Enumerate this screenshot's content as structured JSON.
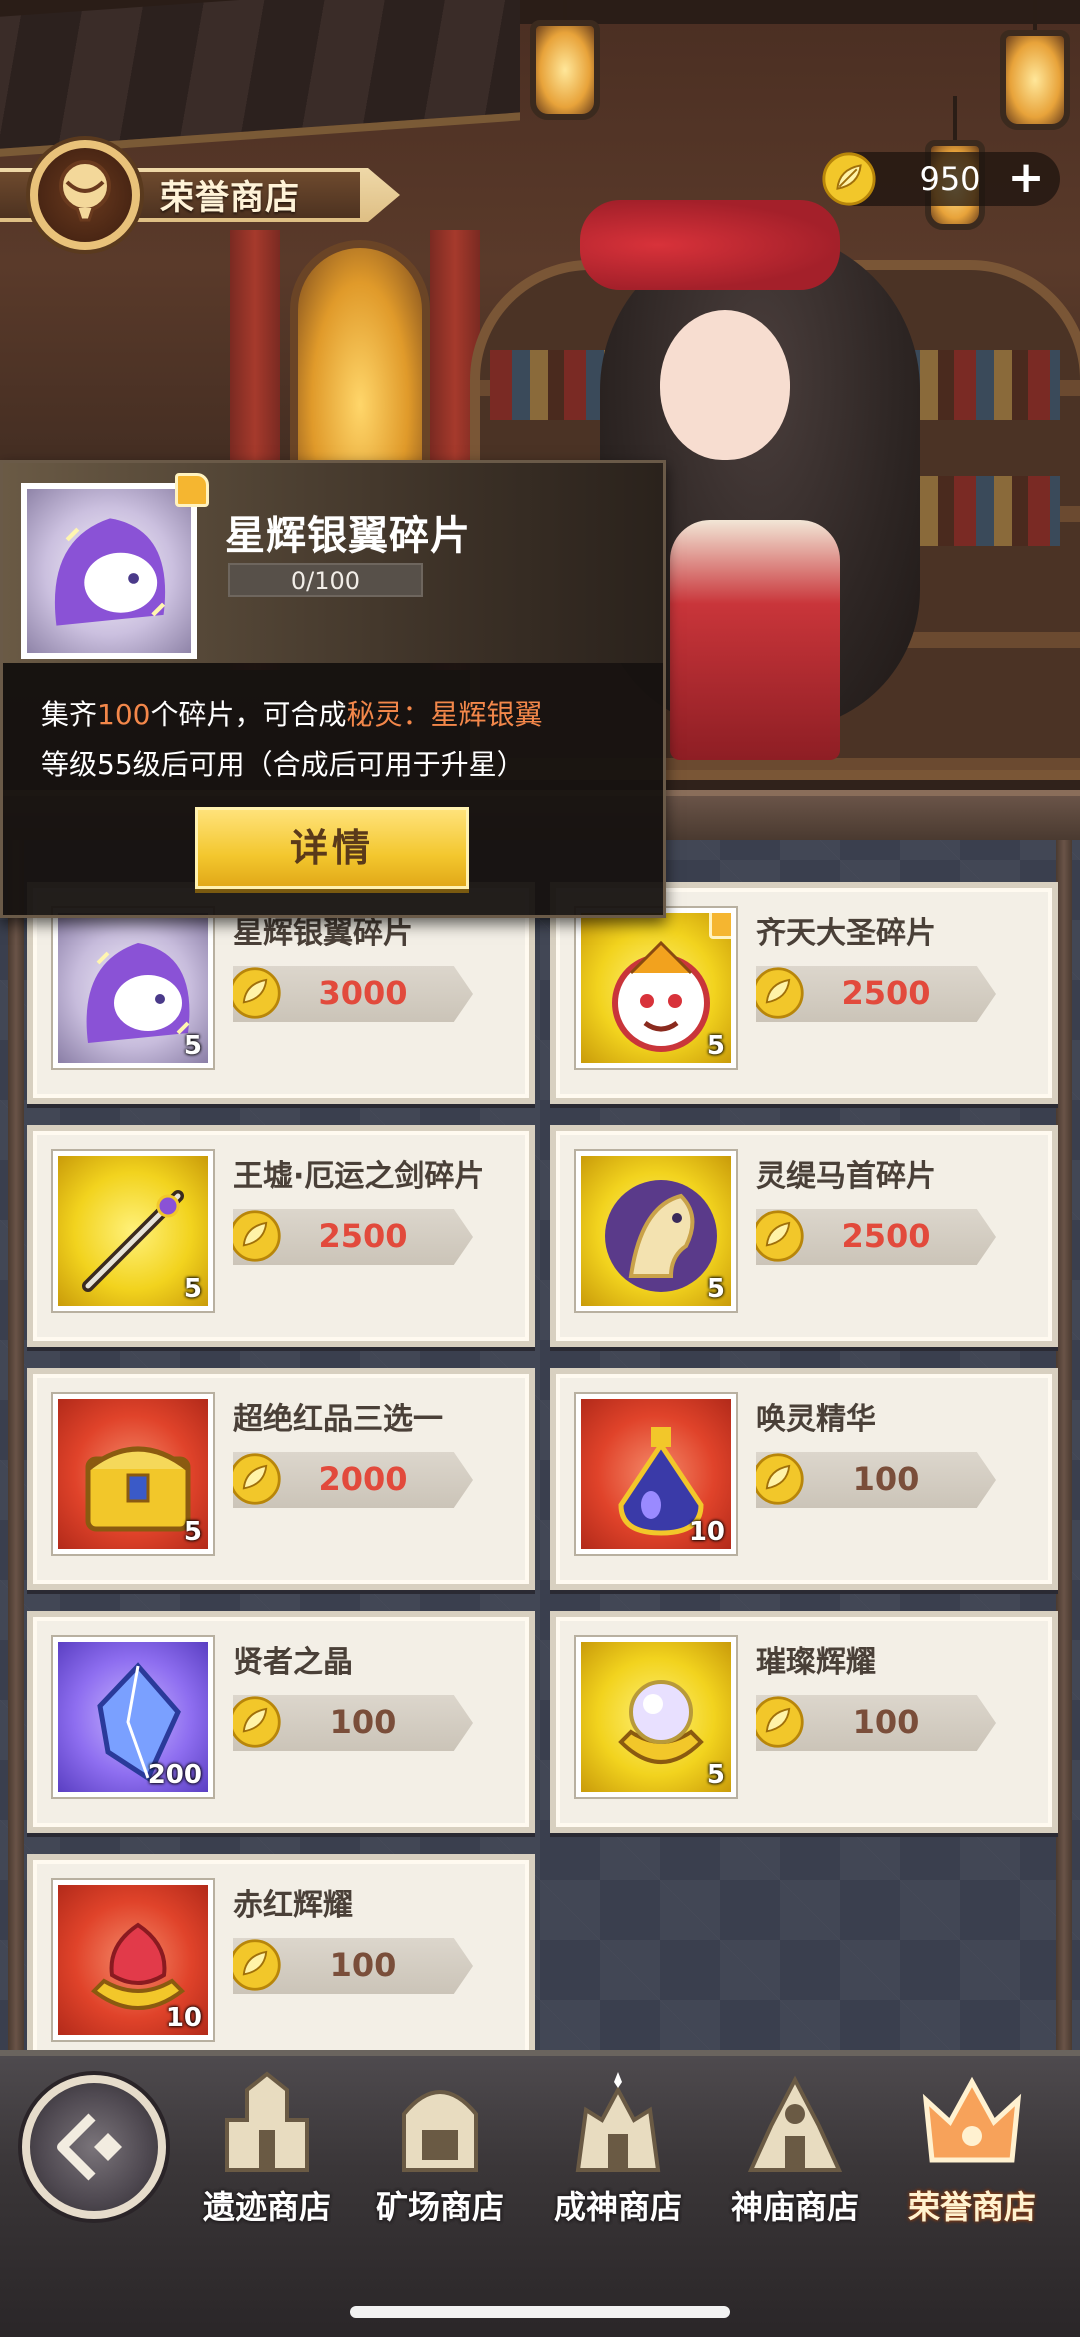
{
  "header": {
    "shop_title": "荣誉商店",
    "currency_amount": "950",
    "currency_icon": "leaf-coin-icon",
    "add_icon": "plus-icon"
  },
  "popup": {
    "item_name": "星辉银翼碎片",
    "progress_text": "0/100",
    "progress_fraction": 0,
    "desc_line1_pre": "集齐",
    "desc_line1_count": "100",
    "desc_line1_mid": "个碎片，可合成",
    "desc_line1_target": "秘灵：星辉银翼",
    "desc_line2": "等级55级后可用（合成后可用于升星）",
    "detail_button": "详情"
  },
  "items": [
    {
      "name": "星辉银翼碎片",
      "price": "3000",
      "qty": "5"
    },
    {
      "name": "齐天大圣碎片",
      "price": "2500",
      "qty": "5"
    },
    {
      "name": "王墟·厄运之剑碎片",
      "price": "2500",
      "qty": "5"
    },
    {
      "name": "灵缇马首碎片",
      "price": "2500",
      "qty": "5"
    },
    {
      "name": "超绝红品三选一",
      "price": "2000",
      "qty": "5"
    },
    {
      "name": "唤灵精华",
      "price": "100",
      "qty": "10"
    },
    {
      "name": "贤者之晶",
      "price": "100",
      "qty": "200"
    },
    {
      "name": "璀璨辉耀",
      "price": "100",
      "qty": "5"
    },
    {
      "name": "赤红辉耀",
      "price": "100",
      "qty": "10"
    }
  ],
  "nav": {
    "back_icon": "back-arrow-icon",
    "tabs": [
      {
        "label": "遗迹商店"
      },
      {
        "label": "矿场商店"
      },
      {
        "label": "成神商店"
      },
      {
        "label": "神庙商店"
      },
      {
        "label": "荣誉商店"
      }
    ]
  },
  "colors": {
    "accent_gold": "#f3c72e",
    "price_red": "#e24a3c",
    "price_brown": "#7a4e3a",
    "highlight_orange": "#f3874a"
  }
}
